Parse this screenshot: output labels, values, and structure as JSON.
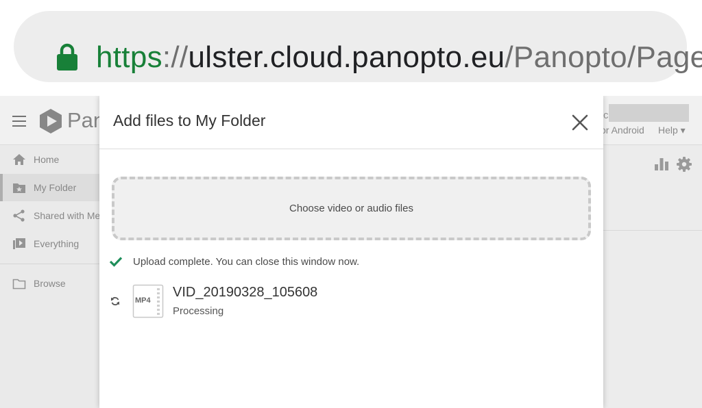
{
  "browser": {
    "url_scheme": "https",
    "url_separator": "://",
    "url_host": "ulster.cloud.panopto.eu",
    "url_path": "/Panopto/Page",
    "lock_icon": "lock-icon",
    "secure_color": "#188038"
  },
  "app": {
    "logo_text": "Pan",
    "header_fragment": "c",
    "header_link_android": "or Android",
    "header_link_help": "Help ▾",
    "sidebar": {
      "items": [
        {
          "label": "Home",
          "icon": "home-icon"
        },
        {
          "label": "My Folder",
          "icon": "folder-star-icon",
          "active": true
        },
        {
          "label": "Shared with Me",
          "icon": "share-icon"
        },
        {
          "label": "Everything",
          "icon": "video-library-icon"
        },
        {
          "label": "Browse",
          "icon": "folder-icon"
        }
      ]
    },
    "toolbar_icons": [
      "stats-icon",
      "gear-icon"
    ]
  },
  "modal": {
    "title": "Add files to My Folder",
    "close_icon": "close-icon",
    "dropzone_label": "Choose video or audio files",
    "status_message": "Upload complete. You can close this window now.",
    "status_color": "#1e8e5a",
    "file": {
      "name": "VID_20190328_105608",
      "type_badge": "MP4",
      "status": "Processing"
    }
  }
}
